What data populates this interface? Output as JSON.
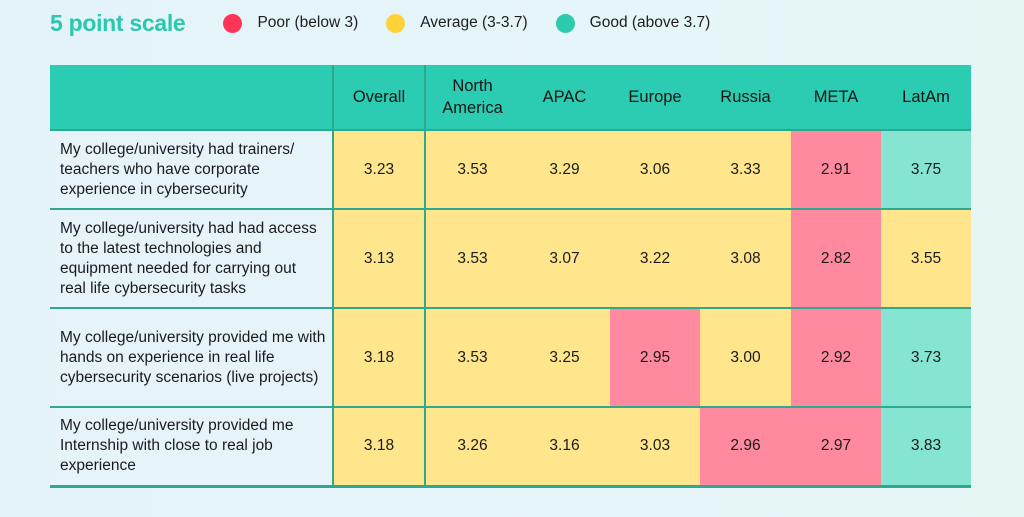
{
  "legend": {
    "title": "5 point scale",
    "items": [
      {
        "label": "Poor (below 3)",
        "color": "#ff3355",
        "key": "poor"
      },
      {
        "label": "Average (3-3.7)",
        "color": "#ffd23a",
        "key": "avg"
      },
      {
        "label": "Good (above 3.7)",
        "color": "#2bcbad",
        "key": "good"
      }
    ]
  },
  "colors": {
    "header": "#2bccb1",
    "poor_cell": "#ff8aa0",
    "average_cell": "#ffe58c",
    "good_cell": "#86e5d2",
    "label_cell": "#e6f4fa",
    "grid_line": "#2ea98f"
  },
  "chart_data": {
    "type": "heatmap",
    "title": "5 point scale",
    "legend": [
      "Poor (below 3)",
      "Average (3-3.7)",
      "Good (above 3.7)"
    ],
    "thresholds": {
      "poor_below": 3,
      "good_above": 3.7
    },
    "columns": [
      "Overall",
      "North America",
      "APAC",
      "Europe",
      "Russia",
      "META",
      "LatAm"
    ],
    "rows": [
      {
        "label": "My college/university had trainers/ teachers who have corporate experience in cybersecurity",
        "values": [
          "3.23",
          "3.53",
          "3.29",
          "3.06",
          "3.33",
          "2.91",
          "3.75"
        ],
        "ratings": [
          "avg",
          "avg",
          "avg",
          "avg",
          "avg",
          "poor",
          "good"
        ]
      },
      {
        "label": "My college/university had had access to the latest technologies and equipment needed for carrying out real life cybersecurity tasks",
        "values": [
          "3.13",
          "3.53",
          "3.07",
          "3.22",
          "3.08",
          "2.82",
          "3.55"
        ],
        "ratings": [
          "avg",
          "avg",
          "avg",
          "avg",
          "avg",
          "poor",
          "avg"
        ]
      },
      {
        "label": "My college/university provided me with hands on experience in real life cybersecurity scenarios (live projects)",
        "values": [
          "3.18",
          "3.53",
          "3.25",
          "2.95",
          "3.00",
          "2.92",
          "3.73"
        ],
        "ratings": [
          "avg",
          "avg",
          "avg",
          "poor",
          "avg",
          "poor",
          "good"
        ]
      },
      {
        "label": "My college/university provided me Internship with close to real job experience",
        "values": [
          "3.18",
          "3.26",
          "3.16",
          "3.03",
          "2.96",
          "2.97",
          "3.83"
        ],
        "ratings": [
          "avg",
          "avg",
          "avg",
          "avg",
          "poor",
          "poor",
          "good"
        ]
      }
    ]
  }
}
